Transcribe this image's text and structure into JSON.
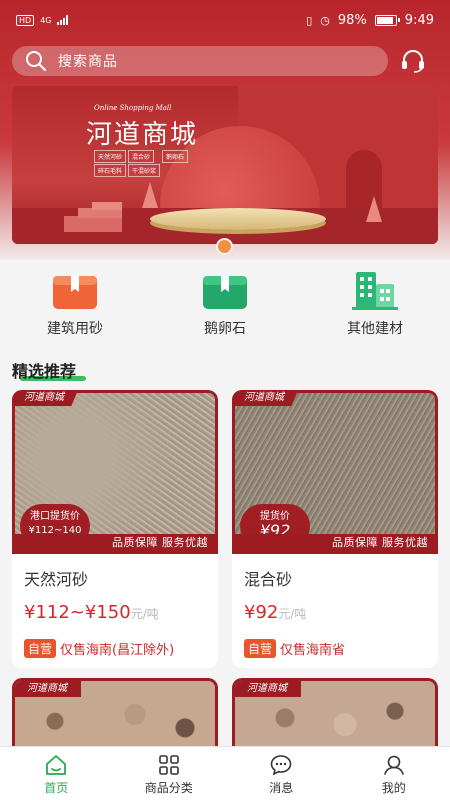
{
  "status": {
    "carrier": "HD",
    "network": "4G",
    "battery": "98%",
    "time": "9:49"
  },
  "search": {
    "placeholder": "搜索商品"
  },
  "banner": {
    "subtitle": "Online Shopping Mall",
    "title": "河道商城",
    "tags": [
      "天然河砂",
      "混合砂",
      "鹅卵石",
      "碎石毛料",
      "干混砂浆"
    ]
  },
  "categories": [
    {
      "label": "建筑用砂",
      "icon": "sand-box-icon"
    },
    {
      "label": "鹅卵石",
      "icon": "pebble-box-icon"
    },
    {
      "label": "其他建材",
      "icon": "building-icon"
    }
  ],
  "section": {
    "title": "精选推荐"
  },
  "products": [
    {
      "store": "河道商城",
      "price_badge_label": "港口提货价",
      "price_badge_value": "¥112~140",
      "ribbon": "品质保障 服务优越",
      "name": "天然河砂",
      "price": "¥112~¥150",
      "unit": "元/吨",
      "self_tag": "自营",
      "region": "仅售海南(昌江除外)"
    },
    {
      "store": "河道商城",
      "price_badge_label": "提货价",
      "price_badge_value": "¥92",
      "ribbon": "品质保障 服务优越",
      "name": "混合砂",
      "price": "¥92",
      "unit": "元/吨",
      "self_tag": "自营",
      "region": "仅售海南省"
    },
    {
      "store": "河道商城"
    },
    {
      "store": "河道商城"
    }
  ],
  "tabs": [
    {
      "label": "首页",
      "icon": "home-icon",
      "active": true
    },
    {
      "label": "商品分类",
      "icon": "grid-icon",
      "active": false
    },
    {
      "label": "消息",
      "icon": "message-icon",
      "active": false
    },
    {
      "label": "我的",
      "icon": "profile-icon",
      "active": false
    }
  ],
  "colors": {
    "brand_red": "#9c1c22",
    "active_green": "#2aa84c",
    "price_red": "#d6262c"
  }
}
